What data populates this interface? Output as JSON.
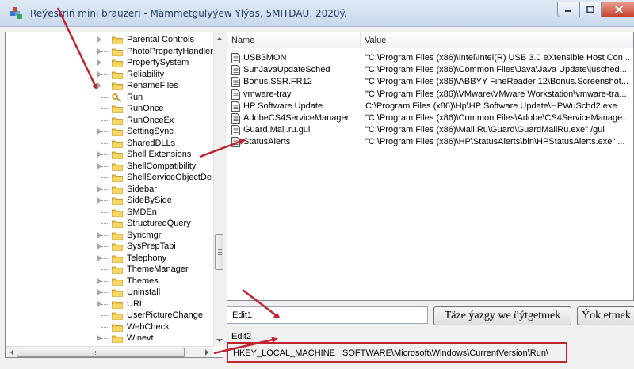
{
  "window": {
    "title": "Reýestriň mini brauzeri - Mämmetgulyýew Ylýas, 5MITDAU, 2020ý."
  },
  "tree": {
    "items": [
      {
        "label": "Parental Controls",
        "expandable": true
      },
      {
        "label": "PhotoPropertyHandler",
        "expandable": true
      },
      {
        "label": "PropertySystem",
        "expandable": true
      },
      {
        "label": "Reliability",
        "expandable": true
      },
      {
        "label": "RenameFiles",
        "expandable": true
      },
      {
        "label": "Run",
        "expandable": false,
        "selected": true
      },
      {
        "label": "RunOnce",
        "expandable": false
      },
      {
        "label": "RunOnceEx",
        "expandable": false
      },
      {
        "label": "SettingSync",
        "expandable": true
      },
      {
        "label": "SharedDLLs",
        "expandable": false
      },
      {
        "label": "Shell Extensions",
        "expandable": true
      },
      {
        "label": "ShellCompatibility",
        "expandable": true
      },
      {
        "label": "ShellServiceObjectDe",
        "expandable": false
      },
      {
        "label": "Sidebar",
        "expandable": true
      },
      {
        "label": "SideBySide",
        "expandable": true
      },
      {
        "label": "SMDEn",
        "expandable": false
      },
      {
        "label": "StructuredQuery",
        "expandable": false
      },
      {
        "label": "Syncmgr",
        "expandable": true
      },
      {
        "label": "SysPrepTapi",
        "expandable": true
      },
      {
        "label": "Telephony",
        "expandable": true
      },
      {
        "label": "ThemeManager",
        "expandable": false
      },
      {
        "label": "Themes",
        "expandable": true
      },
      {
        "label": "Uninstall",
        "expandable": true
      },
      {
        "label": "URL",
        "expandable": true
      },
      {
        "label": "UserPictureChange",
        "expandable": false
      },
      {
        "label": "WebCheck",
        "expandable": false
      },
      {
        "label": "Winevt",
        "expandable": true
      }
    ]
  },
  "list": {
    "columns": {
      "name": "Name",
      "value": "Value"
    },
    "rows": [
      {
        "name": "USB3MON",
        "value": "\"C:\\Program Files (x86)\\Intel\\Intel(R) USB 3.0 eXtensible Host Con..."
      },
      {
        "name": "SunJavaUpdateSched",
        "value": "\"C:\\Program Files (x86)\\Common Files\\Java\\Java Update\\jusched..."
      },
      {
        "name": "Bonus.SSR.FR12",
        "value": "\"C:\\Program Files (x86)\\ABBYY FineReader 12\\Bonus.Screenshot..."
      },
      {
        "name": "vmware-tray",
        "value": "\"C:\\Program Files (x86)\\VMware\\VMware Workstation\\vmware-tra..."
      },
      {
        "name": "HP Software Update",
        "value": "C:\\Program Files (x86)\\Hp\\HP Software Update\\HPWuSchd2.exe"
      },
      {
        "name": "AdobeCS4ServiceManager",
        "value": "\"C:\\Program Files (x86)\\Common Files\\Adobe\\CS4ServiceManage..."
      },
      {
        "name": "Guard.Mail.ru.gui",
        "value": "\"C:\\Program Files (x86)\\Mail.Ru\\Guard\\GuardMailRu.exe\" /gui"
      },
      {
        "name": "StatusAlerts",
        "value": "\"C:\\Program Files (x86)\\HP\\StatusAlerts\\bin\\HPStatusAlerts.exe\" ..."
      }
    ]
  },
  "edit": {
    "edit1_value": "Edit1",
    "change_button": "Täze ýazgy we üýtgetmek",
    "delete_button": "Ýok etmek",
    "edit2_label": "Edit2",
    "path_root": "HKEY_LOCAL_MACHINE",
    "path_sub": "SOFTWARE\\Microsoft\\Windows\\CurrentVersion\\Run\\"
  },
  "colors": {
    "arrow": "#c0232f",
    "folder": "#f2c744",
    "accent": "#1e3a5f"
  }
}
